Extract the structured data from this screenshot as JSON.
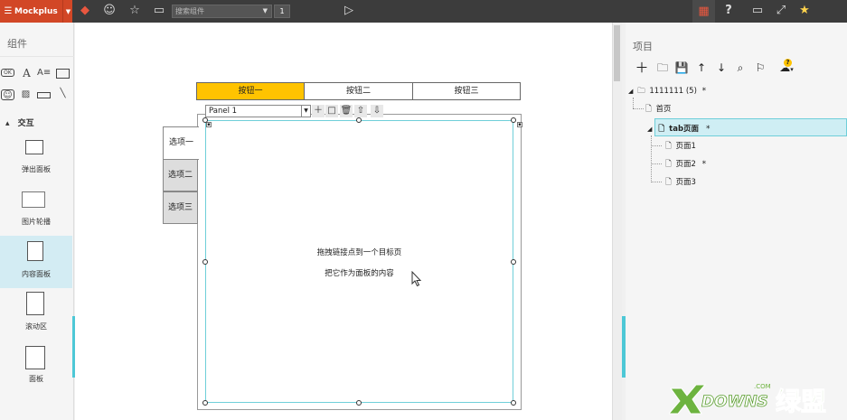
{
  "app": {
    "brand": "Mockplus"
  },
  "toolbar": {
    "search_placeholder": "搜索组件",
    "page_number": "1",
    "help_label": "?"
  },
  "left": {
    "title": "组件",
    "section_label": "交互",
    "components": [
      {
        "label": "弹出面板"
      },
      {
        "label": "图片轮播"
      },
      {
        "label": "内容面板"
      },
      {
        "label": "滚动区"
      },
      {
        "label": "面板"
      }
    ]
  },
  "canvas": {
    "tab_buttons": [
      "按钮一",
      "按钮二",
      "按钮三"
    ],
    "panel_select": "Panel 1",
    "side_tabs": [
      "选项一",
      "选项二",
      "选项三"
    ],
    "hint_line1": "拖拽链接点到一个目标页",
    "hint_line2": "把它作为面板的内容"
  },
  "right": {
    "title": "项目",
    "tree": {
      "root": "1111111 (5)",
      "root_marker": "*",
      "items": [
        {
          "label": "首页"
        },
        {
          "label": "tab页面",
          "marker": "*"
        },
        {
          "label": "页面1"
        },
        {
          "label": "页面2",
          "marker": "*"
        },
        {
          "label": "页面3"
        }
      ]
    }
  },
  "watermark": {
    "text1": "DOWNS",
    "text2": "绿盟",
    "domain": ".COM"
  },
  "colors": {
    "brand": "#d24726",
    "accent": "#4dc8d6",
    "highlight": "#ffc300",
    "topbar": "#3c3c3c"
  }
}
